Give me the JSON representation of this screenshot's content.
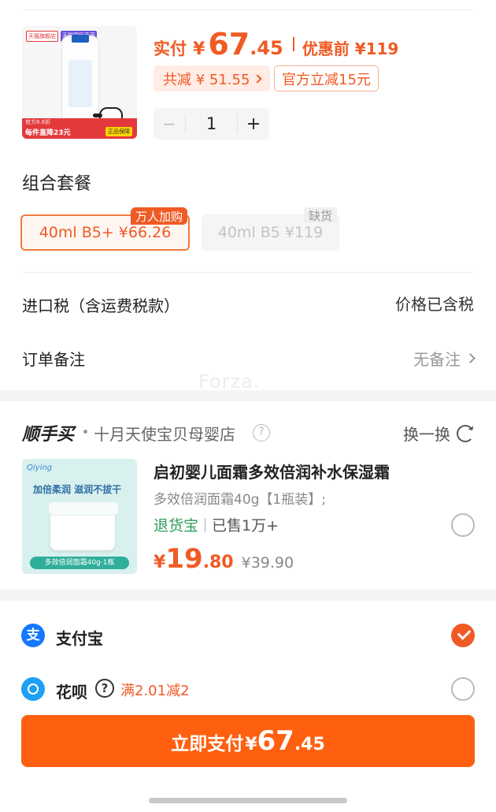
{
  "product": {
    "thumb": {
      "tag1": "天猫旗舰店",
      "tag2": "天猫国际直营",
      "bottom_line1": "官方8.8折",
      "bottom_line2": "每件直降23元",
      "badge": "正品保障"
    },
    "pay_label": "实付",
    "currency": "¥",
    "price_int": "67",
    "price_dec": ".45",
    "before_label": "优惠前 ¥119",
    "discount_label": "共减 ¥ 51.55",
    "official_label": "官方立减15元",
    "quantity": "1",
    "minus": "−",
    "plus": "+"
  },
  "combo": {
    "title": "组合套餐",
    "options": [
      {
        "label": "40ml  B5+  ¥66.26",
        "badge": "万人加购",
        "selected": true
      },
      {
        "label": "40ml  B5  ¥119",
        "badge": "缺货",
        "selected": false
      }
    ]
  },
  "rows": {
    "tax_label": "进口税（含运费税款）",
    "tax_value": "价格已含税",
    "note_label": "订单备注",
    "note_value": "无备注"
  },
  "watermark": "Forza.",
  "shunshoumai": {
    "logo": "顺手买",
    "shop": "十月天使宝贝母婴店",
    "swap_label": "换一换",
    "item": {
      "brand": "Qiying",
      "slogan": "加倍柔润 滋润不拔干",
      "thumb_caption": "多效倍润面霜40g·1瓶",
      "title": "启初婴儿面霜多效倍润补水保湿霜",
      "spec": "多效倍润面霜40g【1瓶装】;",
      "tag": "退货宝",
      "sold": "已售1万+",
      "currency": "¥",
      "price_int": "19",
      "price_dec": ".80",
      "original_price": "¥39.90"
    }
  },
  "payment": {
    "methods": [
      {
        "icon": "alipay-icon",
        "label": "支付宝",
        "selected": true
      },
      {
        "icon": "huabei-icon",
        "label": "花呗",
        "promo": "满2.01减2",
        "selected": false
      }
    ],
    "button_text": "立即支付",
    "currency": "¥",
    "amount_int": "67",
    "amount_dec": ".45"
  },
  "colors": {
    "accent": "#f05a24",
    "button": "#ff6010",
    "alipay": "#1677ff",
    "green_tag": "#2f9c5a"
  }
}
